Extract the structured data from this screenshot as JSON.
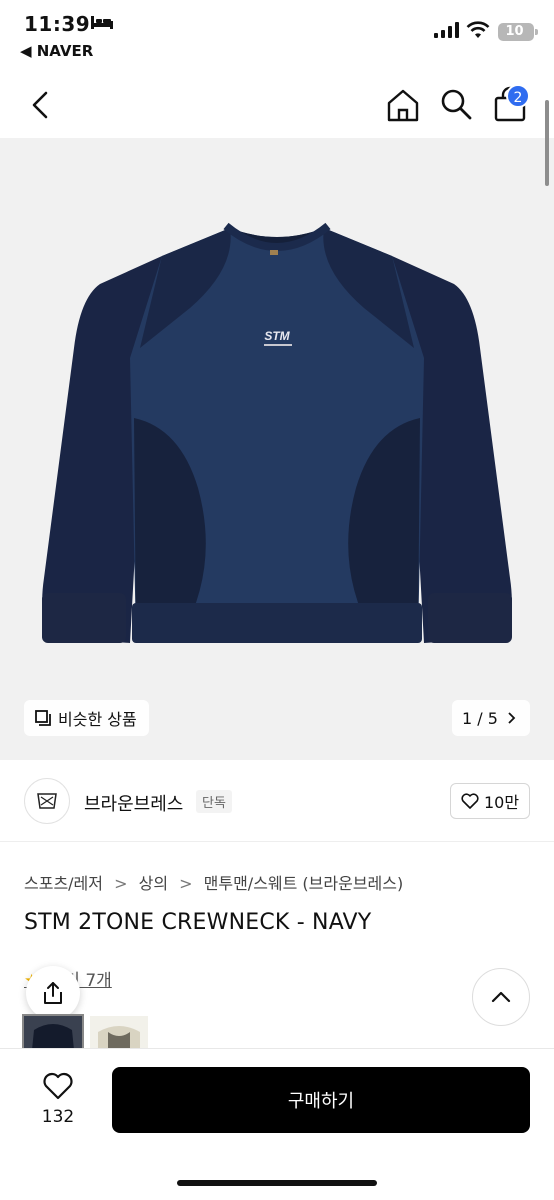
{
  "status_bar": {
    "time": "11:39",
    "back_app": "◀ NAVER",
    "battery": "10"
  },
  "nav": {
    "cart_count": "2"
  },
  "gallery": {
    "similar_label": "비슷한 상품",
    "page_indicator": "1 / 5",
    "shirt_logo": "STM"
  },
  "brand": {
    "name": "브라운브레스",
    "tag": "단독",
    "likes": "10만"
  },
  "breadcrumb": [
    "스포츠/레저",
    "상의",
    "맨투맨/스웨트 (브라운브레스)"
  ],
  "breadcrumb_sep": ">",
  "product": {
    "title": "STM 2TONE CREWNECK - NAVY",
    "review_text": "후기 7개"
  },
  "bottom_bar": {
    "wish_count": "132",
    "buy_label": "구매하기"
  },
  "colors": {
    "accent": "#2f6cf0",
    "buy_button": "#000000",
    "shirt_main": "#243a61",
    "shirt_dark": "#17223d"
  }
}
